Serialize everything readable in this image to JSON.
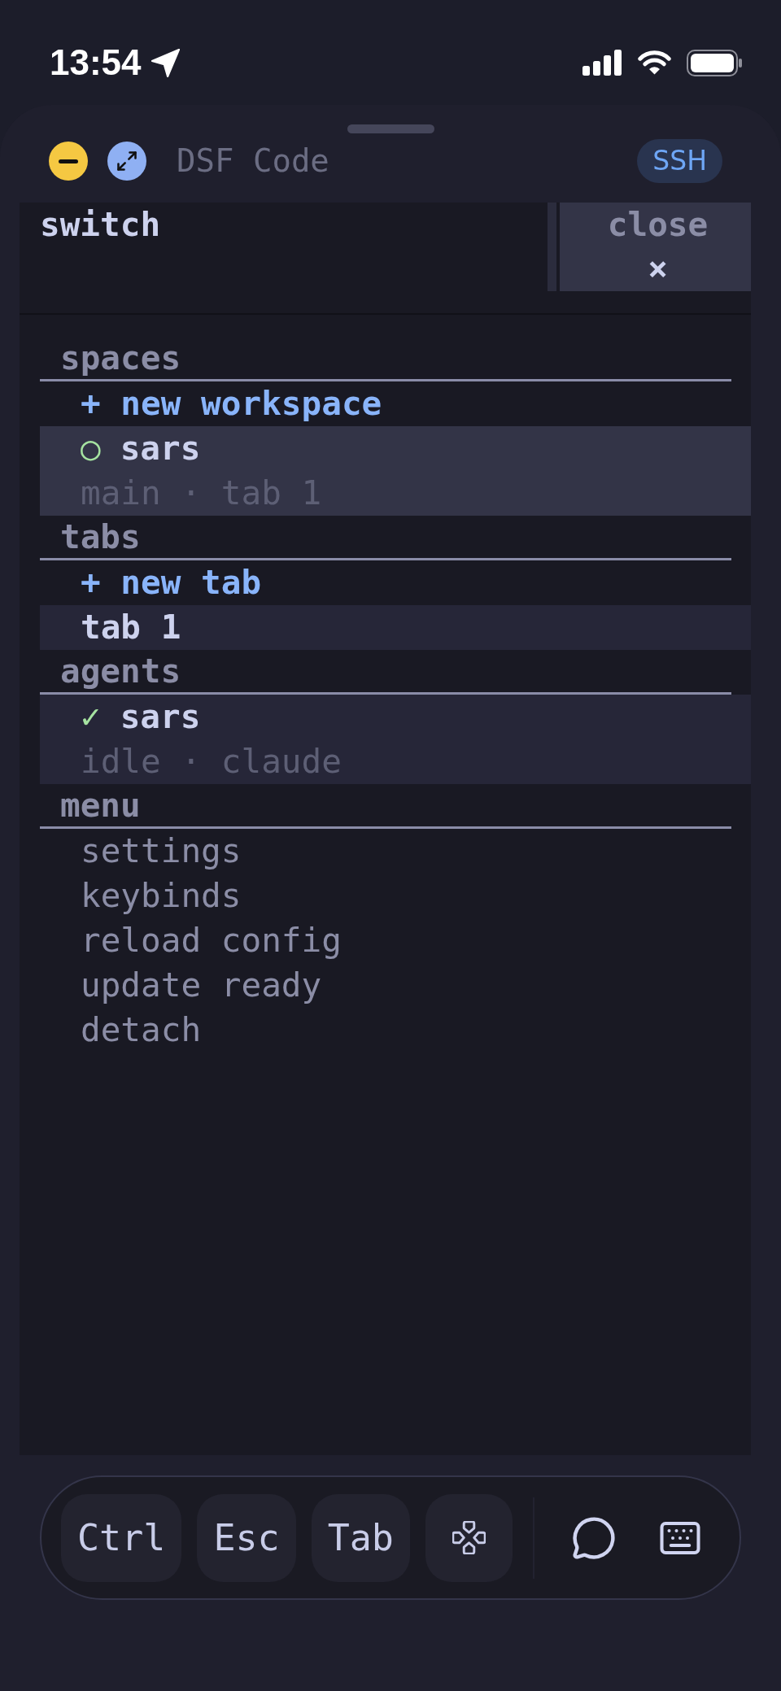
{
  "status_bar": {
    "time": "13:54"
  },
  "title_bar": {
    "title": "DSF Code",
    "badge": "SSH"
  },
  "terminal": {
    "title": "switch",
    "close": {
      "label": "close",
      "symbol": "×"
    },
    "sections": [
      {
        "title": "spaces",
        "items": [
          {
            "kind": "action",
            "label": "+ new workspace",
            "selected": false
          },
          {
            "kind": "entry",
            "marker": "○",
            "label": "sars",
            "detail": "main · tab 1",
            "selected": true
          }
        ]
      },
      {
        "title": "tabs",
        "items": [
          {
            "kind": "action",
            "label": "+ new tab",
            "selected": false,
            "current": false
          },
          {
            "kind": "entry",
            "label": "tab 1",
            "selected": false,
            "current": true
          }
        ]
      },
      {
        "title": "agents",
        "items": [
          {
            "kind": "entry",
            "marker": "✓",
            "label": "sars",
            "detail": "idle · claude",
            "selected": false,
            "current": true
          }
        ]
      },
      {
        "title": "menu",
        "items": [
          {
            "kind": "option",
            "label": "settings",
            "selected": false
          },
          {
            "kind": "option",
            "label": "keybinds",
            "selected": false
          },
          {
            "kind": "option",
            "label": "reload config",
            "selected": false
          },
          {
            "kind": "option",
            "label": "update ready",
            "selected": false
          },
          {
            "kind": "option",
            "label": "detach",
            "selected": false
          }
        ]
      }
    ]
  },
  "toolbar": {
    "keys": [
      "Ctrl",
      "Esc",
      "Tab"
    ]
  }
}
